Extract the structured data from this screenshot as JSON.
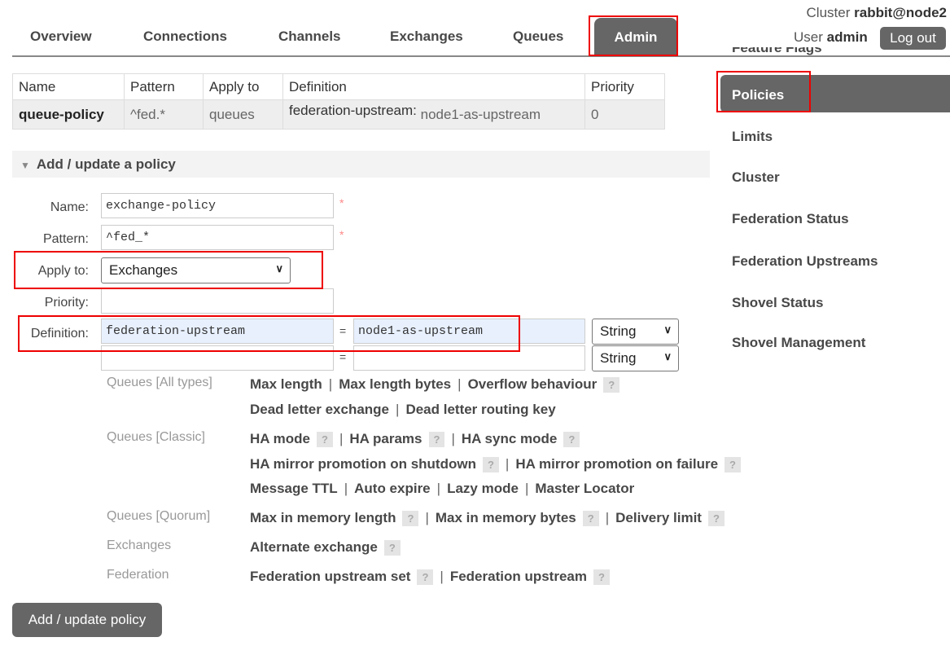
{
  "nav": {
    "tabs": [
      "Overview",
      "Connections",
      "Channels",
      "Exchanges",
      "Queues",
      "Admin"
    ],
    "active": "Admin"
  },
  "header": {
    "cluster_label": "Cluster",
    "cluster": "rabbit@node2",
    "user_label": "User",
    "user": "admin",
    "logout": "Log out"
  },
  "sidebar": {
    "items": [
      "Feature Flags",
      "Policies",
      "Limits",
      "Cluster",
      "Federation Status",
      "Federation Upstreams",
      "Shovel Status",
      "Shovel Management"
    ],
    "active": "Policies"
  },
  "table": {
    "headers": [
      "Name",
      "Pattern",
      "Apply to",
      "Definition",
      "Priority"
    ],
    "rows": [
      {
        "name": "queue-policy",
        "pattern": "^fed.*",
        "apply_to": "queues",
        "def_key": "federation-upstream:",
        "def_value": "node1-as-upstream",
        "priority": "0"
      }
    ]
  },
  "section": {
    "title": "Add / update a policy"
  },
  "form": {
    "name_label": "Name:",
    "name_value": "exchange-policy",
    "pattern_label": "Pattern:",
    "pattern_value": "^fed_*",
    "required": "*",
    "apply_label": "Apply to:",
    "apply_value": "Exchanges",
    "priority_label": "Priority:",
    "priority_value": "",
    "definition_label": "Definition:",
    "eq": "=",
    "definitions": [
      {
        "key": "federation-upstream",
        "value": "node1-as-upstream",
        "type": "String"
      },
      {
        "key": "",
        "value": "",
        "type": "String"
      }
    ]
  },
  "help": {
    "q": "?",
    "sep": "|",
    "queues_all": "Queues [All types]",
    "queues_classic": "Queues [Classic]",
    "queues_quorum": "Queues [Quorum]",
    "exchanges": "Exchanges",
    "federation": "Federation",
    "l": [
      "Max length",
      "Max length bytes",
      "Overflow behaviour",
      "Dead letter exchange",
      "Dead letter routing key",
      "HA mode",
      "HA params",
      "HA sync mode",
      "HA mirror promotion on shutdown",
      "HA mirror promotion on failure",
      "Message TTL",
      "Auto expire",
      "Lazy mode",
      "Master Locator",
      "Max in memory length",
      "Max in memory bytes",
      "Delivery limit",
      "Alternate exchange",
      "Federation upstream set",
      "Federation upstream"
    ]
  },
  "submit": "Add / update policy",
  "colors": {
    "active_tab": "#666666",
    "highlight": "#ee0000",
    "definition_bg": "#e8f0fe"
  }
}
